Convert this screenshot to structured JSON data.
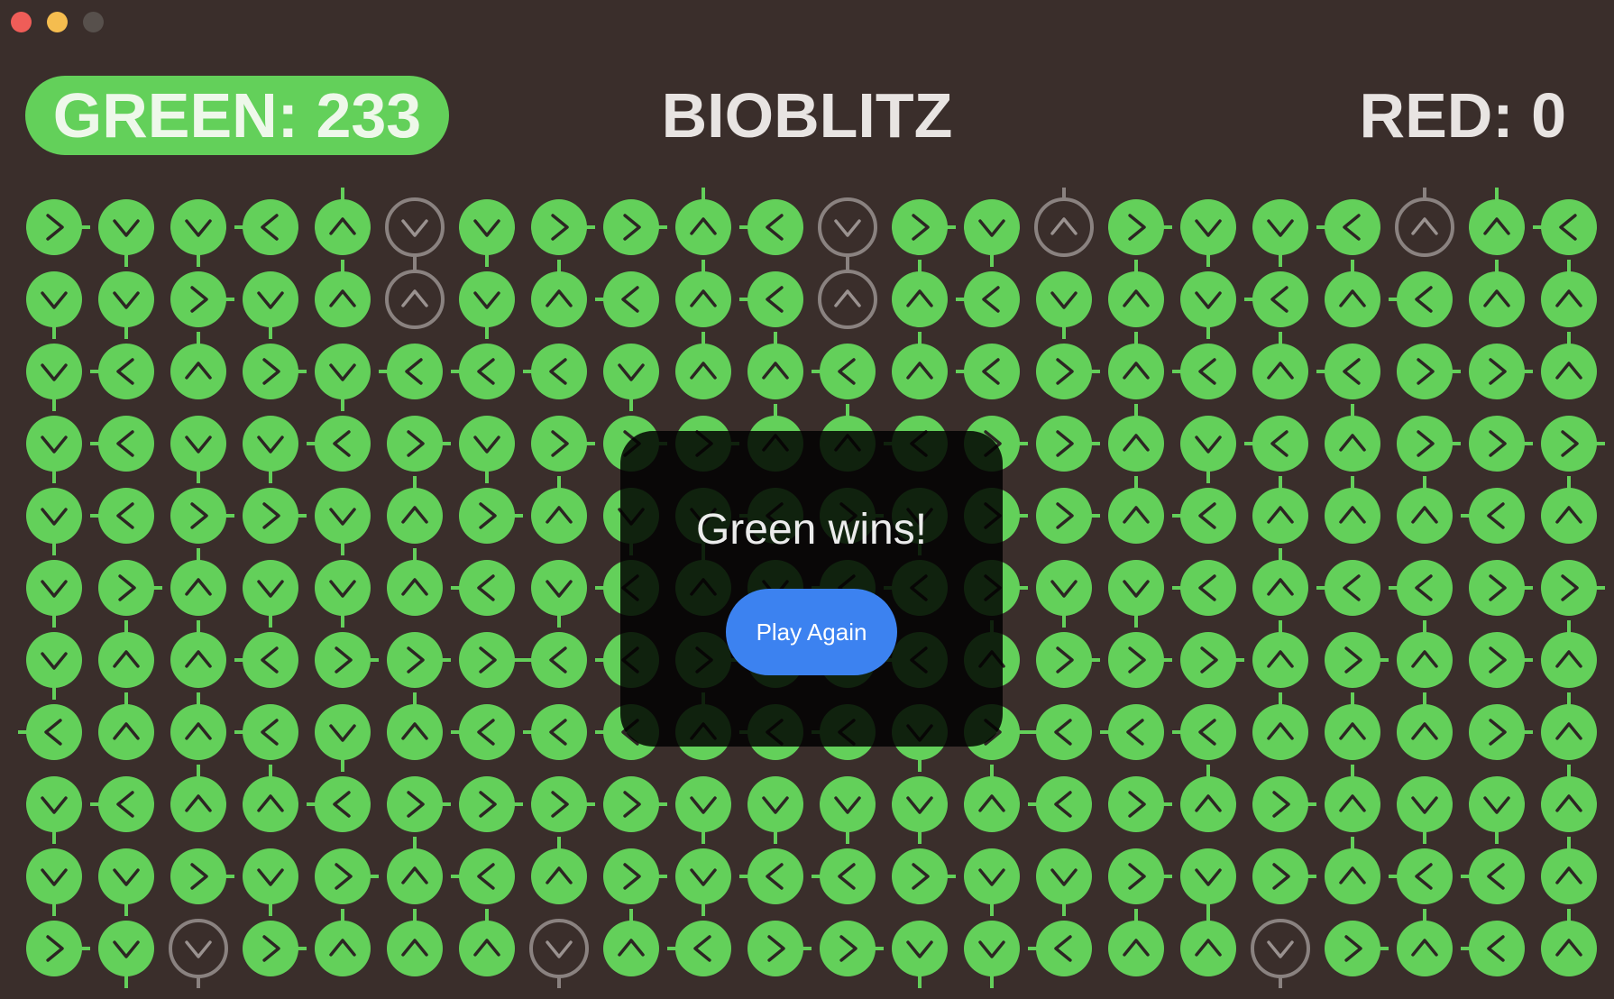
{
  "window": {
    "controls": [
      "close",
      "minimize",
      "maximize"
    ]
  },
  "header": {
    "green_score": "GREEN: 233",
    "title": "BIOBLITZ",
    "red_score": "RED: 0"
  },
  "colors": {
    "green": "#63d05a",
    "neutral": "#8a8280",
    "button": "#3c82f0"
  },
  "board": {
    "rows": 11,
    "cols": 22,
    "legend": "G = green cell, N = neutral grey cell; R/L/U/D = arrow direction",
    "cells": [
      "GR GD GD GL GU ND GD GR GR GU GL ND GR GD NU GR GD GD GL NU GU GL",
      "GD GD GR GD GU NU GD GU GL GU GL NU GU GL GD GU GD GL GU GL GU GU",
      "GD GL GU GR GD GL GL GL GD GU GU GL GU GL GR GU GL GU GL GR GR GU",
      "GD GL GD GD GL GR GD GR GR GR GU GU GL GR GR GU GD GL GU GR GR GR",
      "GD GL GR GR GD GU GR GU GD GD GL GR GD GR GR GU GL GU GU GU GL GU",
      "GD GR GU GD GD GU GL GD GL GU GD GL GL GR GD GD GL GU GL GL GR GR",
      "GD GU GU GL GR GR GR GL GL GR GU GU GL GU GR GR GR GU GR GU GR GU",
      "GL GU GU GL GD GU GL GL GL GU GL GL GD GR GL GL GL GU GU GU GR GU",
      "GD GL GU GU GL GR GR GR GR GD GD GD GD GU GL GR GU GR GU GD GD GU",
      "GD GD GR GD GR GU GL GU GR GD GL GL GR GD GD GR GD GR GU GL GL GU",
      "GR GD ND GR GU GU GU ND GU GL GR GR GD GD GL GU GU ND GR GU GL GU"
    ]
  },
  "dialog": {
    "message": "Green wins!",
    "button_label": "Play Again"
  }
}
